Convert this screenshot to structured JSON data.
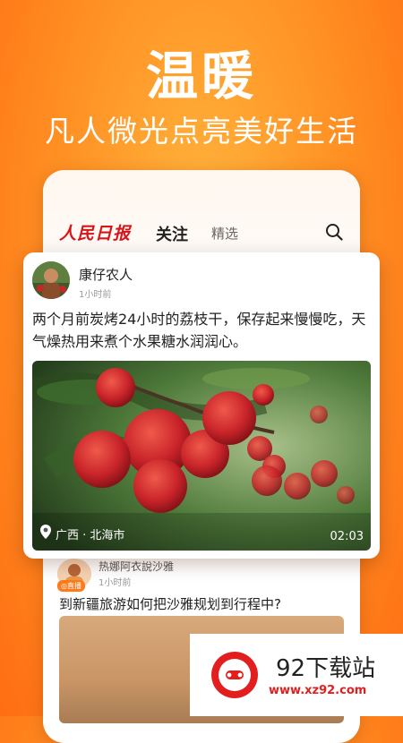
{
  "promo": {
    "headline": "温暖",
    "subline": "凡人微光点亮美好生活"
  },
  "header": {
    "logo": "人民日报",
    "tabs": [
      {
        "label": "关注",
        "active": true
      },
      {
        "label": "精选",
        "active": false
      }
    ],
    "search_icon": "search-icon"
  },
  "feed": {
    "post1": {
      "author": "康仔农人",
      "time": "1小时前",
      "text": "两个月前炭烤24小时的荔枝干，保存起来慢慢吃，天气燥热用来煮个水果糖水润润心。",
      "location": "广西 · 北海市",
      "duration": "02:03",
      "location_icon": "location-pin-icon"
    },
    "post2": {
      "author": "热娜阿衣說沙雅",
      "live_badge": "◎直播",
      "time": "1小时前",
      "title": "到新疆旅游如何把沙雅规划到行程中?"
    }
  },
  "watermark": {
    "name": "92下载站",
    "url": "www.xz92.com"
  },
  "colors": {
    "accent": "#ff8a1f",
    "brand_red": "#d8141a"
  }
}
